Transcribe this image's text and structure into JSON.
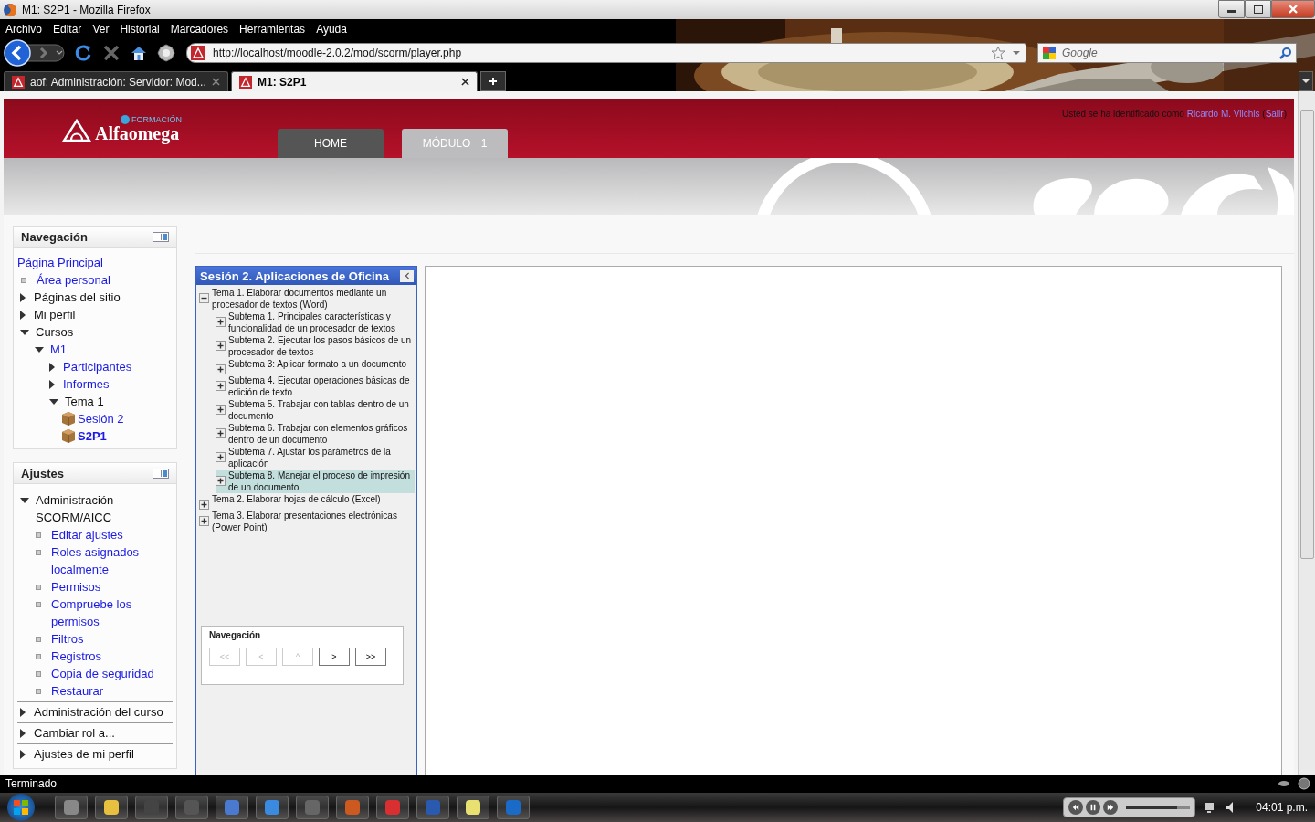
{
  "window": {
    "title": "M1: S2P1 - Mozilla Firefox"
  },
  "menu": [
    "Archivo",
    "Editar",
    "Ver",
    "Historial",
    "Marcadores",
    "Herramientas",
    "Ayuda"
  ],
  "address": {
    "url": "http://localhost/moodle-2.0.2/mod/scorm/player.php"
  },
  "search": {
    "placeholder": "Google"
  },
  "tabs": [
    {
      "label": "aof: Administración: Servidor: Mod...",
      "selected": false
    },
    {
      "label": "M1: S2P1",
      "selected": true
    }
  ],
  "header": {
    "brand": "Alfaomega",
    "tagline": "FORMACIÓN",
    "nav_tabs": [
      {
        "label": "HOME",
        "selected": false
      },
      {
        "label": "MÓDULO 1",
        "selected": true
      }
    ],
    "login": {
      "prefix": "Usted se ha identificado como",
      "user": "Ricardo M. Vilchis",
      "open": "(",
      "logout": "Salir",
      "close": ")"
    }
  },
  "navigation": {
    "title": "Navegación",
    "items": [
      {
        "label": "Página Principal",
        "kind": "plain",
        "link": true
      },
      {
        "label": "Área personal",
        "kind": "leaf",
        "link": true
      },
      {
        "label": "Páginas del sitio",
        "kind": "branch",
        "link": false,
        "expanded": false
      },
      {
        "label": "Mi perfil",
        "kind": "branch",
        "link": false,
        "expanded": false
      },
      {
        "label": "Cursos",
        "kind": "branch",
        "link": false,
        "expanded": true,
        "children": [
          {
            "label": "M1",
            "kind": "branch",
            "link": true,
            "expanded": true,
            "children": [
              {
                "label": "Participantes",
                "kind": "branch",
                "link": true,
                "expanded": false
              },
              {
                "label": "Informes",
                "kind": "branch",
                "link": true,
                "expanded": false
              },
              {
                "label": "Tema 1",
                "kind": "branch",
                "link": false,
                "expanded": true,
                "children": [
                  {
                    "label": "Sesión 2",
                    "kind": "activity",
                    "link": true,
                    "selected": false
                  },
                  {
                    "label": "S2P1",
                    "kind": "activity",
                    "link": true,
                    "selected": true
                  }
                ]
              }
            ]
          }
        ]
      }
    ]
  },
  "settings": {
    "title": "Ajustes",
    "items": [
      {
        "label": "Administración SCORM/AICC",
        "kind": "branch",
        "link": false,
        "expanded": true,
        "children": [
          {
            "label": "Editar ajustes",
            "kind": "leaf",
            "link": true
          },
          {
            "label": "Roles asignados localmente",
            "kind": "leaf",
            "link": true
          },
          {
            "label": "Permisos",
            "kind": "leaf",
            "link": true
          },
          {
            "label": "Compruebe los permisos",
            "kind": "leaf",
            "link": true
          },
          {
            "label": "Filtros",
            "kind": "leaf",
            "link": true
          },
          {
            "label": "Registros",
            "kind": "leaf",
            "link": true
          },
          {
            "label": "Copia de seguridad",
            "kind": "leaf",
            "link": true
          },
          {
            "label": "Restaurar",
            "kind": "leaf",
            "link": true
          }
        ]
      },
      {
        "label": "Administración del curso",
        "kind": "branch",
        "link": false,
        "expanded": false
      },
      {
        "label": "Cambiar rol a...",
        "kind": "branch",
        "link": false,
        "expanded": false
      },
      {
        "label": "Ajustes de mi perfil",
        "kind": "branch",
        "link": false,
        "expanded": false
      }
    ]
  },
  "scorm": {
    "title": "Sesión 2. Aplicaciones de Oficina",
    "toc": [
      {
        "label": "Tema 1. Elaborar documentos mediante un procesador de textos (Word)",
        "expanded": true,
        "selected": false,
        "children": [
          {
            "label": "Subtema 1. Principales características y funcionalidad de un procesador de textos",
            "expanded": false,
            "selected": false
          },
          {
            "label": "Subtema 2. Ejecutar los pasos básicos de un procesador de textos",
            "expanded": false,
            "selected": false
          },
          {
            "label": "Subtema 3: Aplicar formato a un documento",
            "expanded": false,
            "selected": false
          },
          {
            "label": "Subtema 4. Ejecutar operaciones básicas de edición de texto",
            "expanded": false,
            "selected": false
          },
          {
            "label": "Subtema 5. Trabajar con tablas dentro de un documento",
            "expanded": false,
            "selected": false
          },
          {
            "label": "Subtema 6. Trabajar con elementos gráficos dentro de un documento",
            "expanded": false,
            "selected": false
          },
          {
            "label": "Subtema 7. Ajustar los parámetros de la aplicación",
            "expanded": false,
            "selected": false
          },
          {
            "label": "Subtema 8. Manejar el proceso de impresión de un documento",
            "expanded": false,
            "selected": true
          }
        ]
      },
      {
        "label": "Tema 2. Elaborar hojas de cálculo (Excel)",
        "expanded": false,
        "selected": false
      },
      {
        "label": "Tema 3. Elaborar presentaciones electrónicas (Power Point)",
        "expanded": false,
        "selected": false
      }
    ],
    "nav": {
      "title": "Navegación",
      "buttons": [
        {
          "label": "<<",
          "disabled": true
        },
        {
          "label": "<",
          "disabled": true
        },
        {
          "label": "^",
          "disabled": true
        },
        {
          "label": ">",
          "disabled": false
        },
        {
          "label": ">>",
          "disabled": false
        }
      ]
    }
  },
  "status": "Terminado",
  "taskbar": {
    "volume": {
      "level": 0.8
    },
    "clock": "04:01 p.m."
  }
}
